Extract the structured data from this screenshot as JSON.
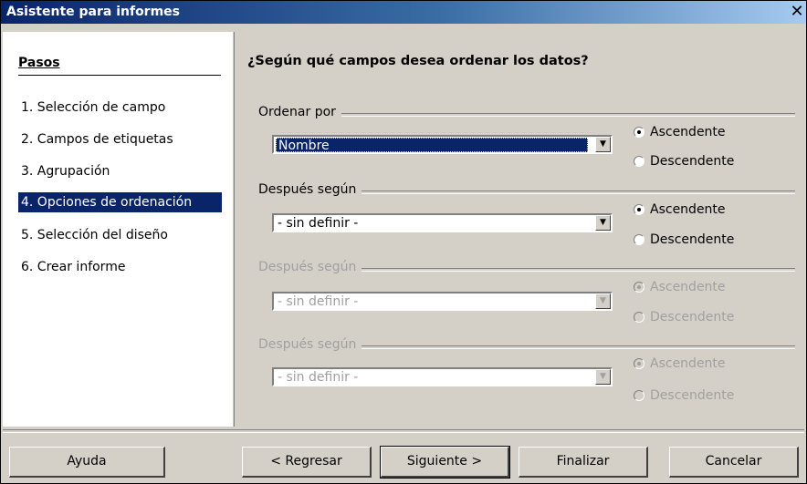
{
  "window": {
    "title": "Asistente para informes",
    "close": "✕"
  },
  "sidebar": {
    "title": "Pasos",
    "steps": [
      "1.  Selección de campo",
      "2.  Campos de etiquetas",
      "3.  Agrupación",
      "4.  Opciones de ordenación",
      "5.  Selección del diseño",
      "6.  Crear informe"
    ]
  },
  "main": {
    "heading": "¿Según qué campos desea ordenar los datos?",
    "sections": [
      {
        "label": "Ordenar por",
        "value": "Nombre",
        "asc": "Ascendente",
        "desc": "Descendente",
        "enabled": true
      },
      {
        "label": "Después según",
        "value": "- sin definir -",
        "asc": "Ascendente",
        "desc": "Descendente",
        "enabled": true
      },
      {
        "label": "Después según",
        "value": "- sin definir -",
        "asc": "Ascendente",
        "desc": "Descendente",
        "enabled": false
      },
      {
        "label": "Después según",
        "value": "- sin definir -",
        "asc": "Ascendente",
        "desc": "Descendente",
        "enabled": false
      }
    ]
  },
  "buttons": {
    "help": "Ayuda",
    "back": "< Regresar",
    "next": "Siguiente >",
    "finish": "Finalizar",
    "cancel": "Cancelar"
  },
  "colors": {
    "accent": "#0a246a",
    "face": "#d4d0c8"
  }
}
